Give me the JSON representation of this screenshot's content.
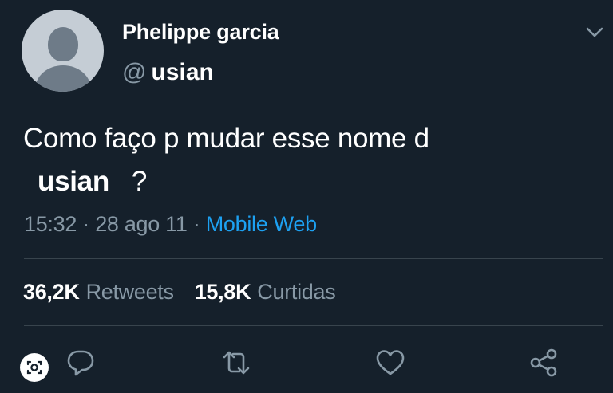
{
  "user": {
    "display_name": "Phelippe garcia",
    "at_symbol": "@",
    "handle": "usian"
  },
  "tweet": {
    "text_line1": "Como faço p mudar esse nome d",
    "mention": "usian",
    "question_mark": "?",
    "time": "15:32",
    "separator1": "·",
    "date": "28 ago 11",
    "separator2": "·",
    "source": "Mobile Web"
  },
  "stats": {
    "retweets_count": "36,2K",
    "retweets_label": "Retweets",
    "likes_count": "15,8K",
    "likes_label": "Curtidas"
  },
  "colors": {
    "background": "#15202b",
    "muted_text": "#8899a6",
    "link": "#1da1f2",
    "divider": "#38444d"
  },
  "icons": [
    "chevron-down-icon",
    "reply-icon",
    "retweet-icon",
    "like-icon",
    "share-icon",
    "lens-icon"
  ]
}
